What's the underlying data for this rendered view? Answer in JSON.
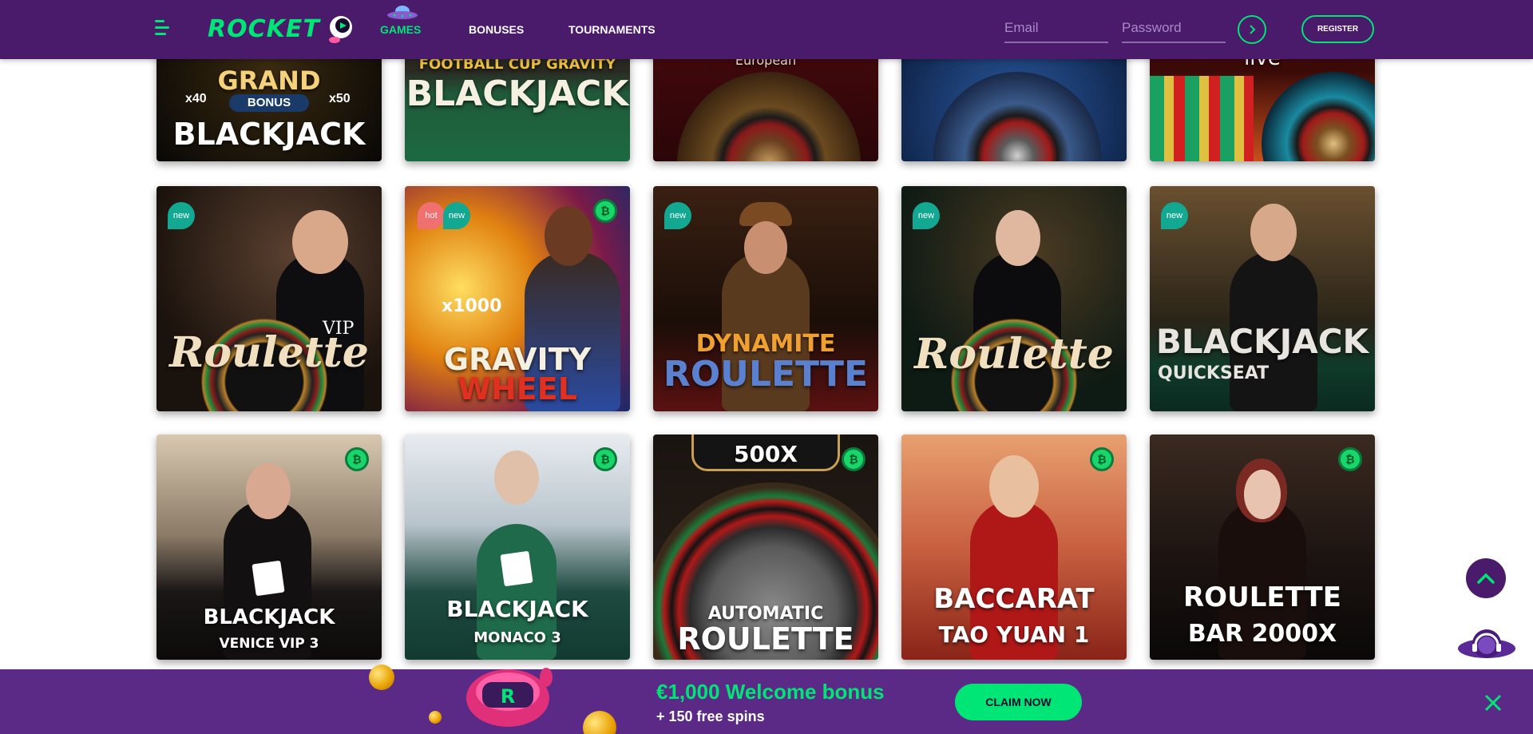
{
  "header": {
    "logo_text": "ROCKET",
    "nav": [
      {
        "label": "GAMES",
        "active": true
      },
      {
        "label": "BONUSES",
        "active": false
      },
      {
        "label": "TOURNAMENTS",
        "active": false
      }
    ],
    "email_placeholder": "Email",
    "password_placeholder": "Password",
    "register_label": "REGISTER"
  },
  "games_row1": [
    {
      "line1": "GRAND",
      "line2": "BLACKJACK",
      "extra": "BONUS",
      "left_mult": "x40",
      "right_mult": "x50"
    },
    {
      "line1": "FOOTBALL CUP GRAVITY",
      "line2": "BLACKJACK"
    },
    {
      "line1": "European",
      "line2": ""
    },
    {
      "line1": "",
      "line2": ""
    },
    {
      "line1": "live",
      "line2": ""
    }
  ],
  "games_row2": [
    {
      "badges": [
        "new"
      ],
      "line1": "Roulette",
      "line2": "VIP",
      "coin": false
    },
    {
      "badges": [
        "hot",
        "new"
      ],
      "line1": "GRAVITY",
      "line2": "WHEEL",
      "extra": "x1000",
      "coin": true
    },
    {
      "badges": [
        "new"
      ],
      "line1": "DYNAMITE",
      "line2": "ROULETTE",
      "coin": false
    },
    {
      "badges": [
        "new"
      ],
      "line1": "Roulette",
      "line2": "",
      "coin": false
    },
    {
      "badges": [
        "new"
      ],
      "line1": "BLACKJACK",
      "line2": "QUICKSEAT",
      "coin": false
    }
  ],
  "games_row3": [
    {
      "line1": "BLACKJACK",
      "line2": "VENICE VIP 3",
      "coin": true
    },
    {
      "line1": "BLACKJACK",
      "line2": "MONACO 3",
      "coin": true
    },
    {
      "line1": "AUTOMATIC",
      "line2": "ROULETTE",
      "extra": "500X",
      "coin": true
    },
    {
      "line1": "BACCARAT",
      "line2": "TAO YUAN 1",
      "coin": true
    },
    {
      "line1": "ROULETTE",
      "line2": "BAR 2000X",
      "coin": true
    }
  ],
  "coin_symbol": "₿",
  "promo": {
    "title": "€1,000 Welcome bonus",
    "subtitle": "+ 150 free spins",
    "cta": "CLAIM NOW"
  },
  "colors": {
    "header_bg": "#4a1a6b",
    "accent": "#00e676",
    "promo_bg": "#5a2a86"
  }
}
